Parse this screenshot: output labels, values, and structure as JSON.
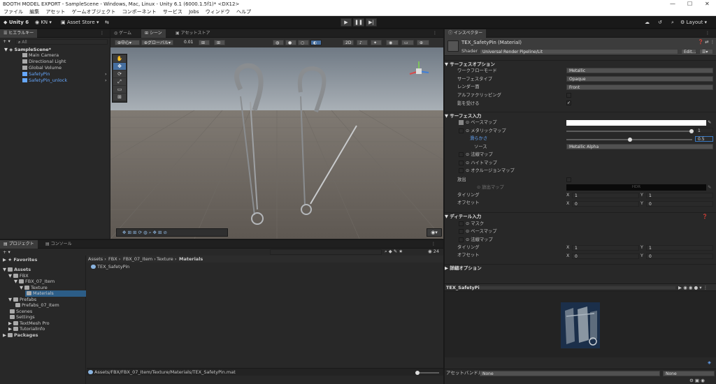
{
  "window": {
    "title": "BOOTH MODEL EXPORT - SampleScene - Windows, Mac, Linux - Unity 6.1 (6000.1.5f1)* <DX12>",
    "minimize": "—",
    "maximize": "☐",
    "close": "✕"
  },
  "menu": [
    "ファイル",
    "編集",
    "アセット",
    "ゲームオブジェクト",
    "コンポーネント",
    "サービス",
    "Jobs",
    "ウィンドウ",
    "ヘルプ"
  ],
  "toolbar": {
    "unity": "Unity 6",
    "account": "KN",
    "asset_store": "Asset Store",
    "layout": "Layout"
  },
  "hierarchy": {
    "tab": "ヒエラルキー",
    "search": "All",
    "scene": "SampleScene*",
    "items": [
      "Main Camera",
      "Directional Light",
      "Global Volume",
      "SafetyPin",
      "SafetyPin_unlock"
    ]
  },
  "scene_tabs": [
    "ゲーム",
    "シーン",
    "アセットストア"
  ],
  "scene_toolbar": {
    "pivot": "中心",
    "space": "グローバル",
    "snap": "0.01"
  },
  "project": {
    "tabs": [
      "プロジェクト",
      "コンソール"
    ],
    "favorites": "Favorites",
    "count": "24",
    "tree": [
      {
        "label": "Assets",
        "level": 0
      },
      {
        "label": "FBX",
        "level": 1
      },
      {
        "label": "FBX_07_Item",
        "level": 2
      },
      {
        "label": "Texture",
        "level": 3
      },
      {
        "label": "Materials",
        "level": 4
      },
      {
        "label": "Prefabs",
        "level": 1
      },
      {
        "label": "Prefabs_07_Item",
        "level": 2
      },
      {
        "label": "Scenes",
        "level": 1
      },
      {
        "label": "Settings",
        "level": 1
      },
      {
        "label": "TextMesh Pro",
        "level": 1
      },
      {
        "label": "TutorialInfo",
        "level": 1
      },
      {
        "label": "Packages",
        "level": 0
      }
    ],
    "breadcrumb": [
      "Assets",
      "FBX",
      "FBX_07_Item",
      "Texture",
      "Materials"
    ],
    "file": "TEX_SafetyPin",
    "path": "Assets/FBX/FBX_07_Item/Texture/Materials/TEX_SafetyPin.mat"
  },
  "inspector": {
    "tab": "インスペクター",
    "title": "TEX_SafetyPin (Material)",
    "shader_label": "Shader",
    "shader": "Universal Render Pipeline/Lit",
    "edit": "Edit...",
    "surface_options": "サーフェスオプション",
    "workflow_label": "ワークフローモード",
    "workflow": "Metallic",
    "surface_type_label": "サーフェスタイプ",
    "surface_type": "Opaque",
    "render_face_label": "レンダー面",
    "render_face": "Front",
    "alpha_clip_label": "アルファクリッピング",
    "shadows_label": "影を受ける",
    "surface_inputs": "サーフェス入力",
    "base_map": "ベースマップ",
    "metallic_map": "メタリックマップ",
    "metallic_value": "1",
    "smoothness_label": "滑らかさ",
    "smoothness_value": "0.5",
    "source_label": "ソース",
    "source": "Metallic Alpha",
    "normal_map": "法線マップ",
    "height_map": "ハイトマップ",
    "occlusion_map": "オクルージョンマップ",
    "emission_label": "放出",
    "emission_map": "放出マップ",
    "hdr": "HDR",
    "tiling_label": "タイリング",
    "offset_label": "オフセット",
    "x": "X",
    "y": "Y",
    "tiling_x": "1",
    "tiling_y": "1",
    "offset_x": "0",
    "offset_y": "0",
    "detail_inputs": "ディテール入力",
    "mask": "マスク",
    "detail_base_map": "ベースマップ",
    "detail_normal_map": "法線マップ",
    "dtiling_x": "1",
    "dtiling_y": "1",
    "doffset_x": "0",
    "doffset_y": "0",
    "advanced": "詳細オプション",
    "preview_title": "TEX_SafetyPin",
    "asset_bundle_label": "アセットバンドル",
    "asset_bundle": "None",
    "asset_variant": "None"
  },
  "colors": {
    "accent": "#2c5d87",
    "blue_text": "#66a8ff"
  }
}
